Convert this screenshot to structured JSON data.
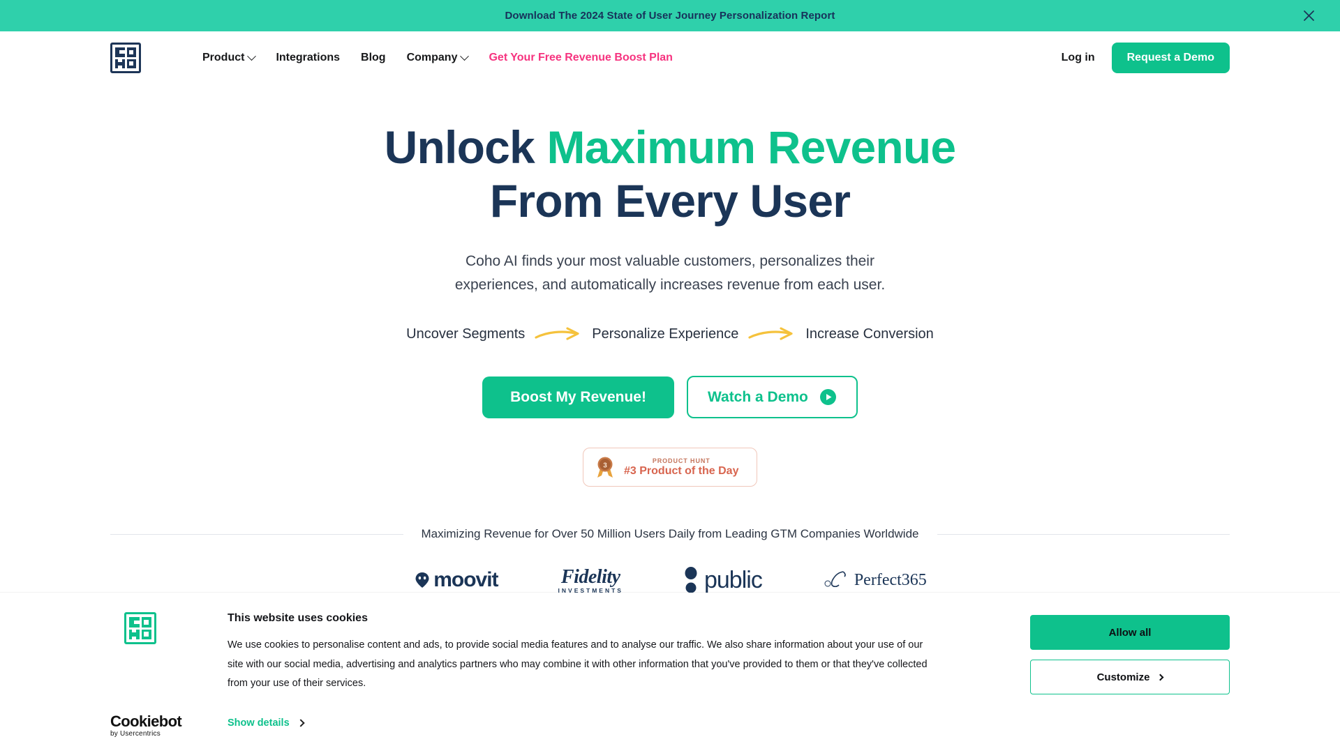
{
  "announcement": {
    "text": "Download The 2024 State of User Journey Personalization Report",
    "close_icon": "close-icon",
    "background": "#2fd0ab"
  },
  "header": {
    "logo_alt": "COHO",
    "nav": [
      {
        "label": "Product",
        "has_dropdown": true,
        "accent": false
      },
      {
        "label": "Integrations",
        "has_dropdown": false,
        "accent": false
      },
      {
        "label": "Blog",
        "has_dropdown": false,
        "accent": false
      },
      {
        "label": "Company",
        "has_dropdown": true,
        "accent": false
      },
      {
        "label": "Get Your Free Revenue Boost Plan",
        "has_dropdown": false,
        "accent": true
      }
    ],
    "login_label": "Log in",
    "demo_label": "Request a Demo",
    "accent_pink": "#f6337f",
    "accent_green": "#0ec18c"
  },
  "hero": {
    "headline_part1": "Unlock ",
    "headline_highlight": "Maximum Revenue",
    "headline_part2": "From Every User",
    "subtitle_line1": "Coho AI finds your most valuable customers, personalizes their",
    "subtitle_line2": "experiences, and automatically increases revenue from each user.",
    "steps": [
      "Uncover Segments",
      "Personalize Experience",
      "Increase Conversion"
    ],
    "arrow_color": "#f5c23c",
    "primary_cta": "Boost My Revenue!",
    "secondary_cta": "Watch a Demo",
    "play_icon": "play-icon",
    "navy": "#1b3557",
    "green": "#0ec18c"
  },
  "product_hunt": {
    "kicker": "PRODUCT HUNT",
    "title": "#3 Product of the Day",
    "rank": "3",
    "medal_icon": "medal-icon",
    "accent": "#d8654f"
  },
  "social_proof": {
    "text": "Maximizing Revenue for Over 50 Million Users Daily from Leading GTM Companies Worldwide",
    "logos": [
      {
        "name": "moovit",
        "label": "moovit"
      },
      {
        "name": "fidelity-investments",
        "label": "Fidelity",
        "sub": "INVESTMENTS"
      },
      {
        "name": "public",
        "label": "public"
      },
      {
        "name": "perfect365",
        "label": "Perfect365"
      }
    ]
  },
  "cookie_banner": {
    "title": "This website uses cookies",
    "body": "We use cookies to personalise content and ads, to provide social media features and to analyse our traffic. We also share information about your use of our site with our social media, advertising and analytics partners who may combine it with other information that you've provided to them or that they've collected from your use of their services.",
    "show_details": "Show details",
    "allow_all": "Allow all",
    "customize": "Customize",
    "provider_name": "Cookiebot",
    "provider_sub": "by Usercentrics",
    "green": "#0ec18c"
  }
}
